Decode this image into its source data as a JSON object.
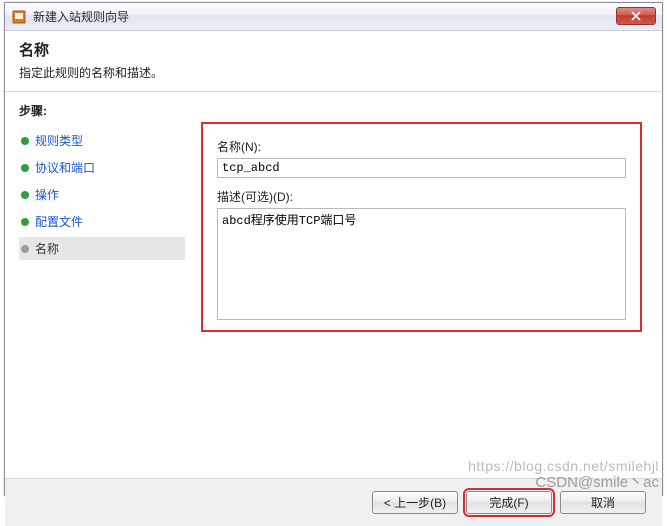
{
  "titlebar": {
    "title": "新建入站规则向导"
  },
  "header": {
    "heading": "名称",
    "subheading": "指定此规则的名称和描述。"
  },
  "sidebar": {
    "steps_label": "步骤:",
    "items": [
      {
        "label": "规则类型"
      },
      {
        "label": "协议和端口"
      },
      {
        "label": "操作"
      },
      {
        "label": "配置文件"
      },
      {
        "label": "名称"
      }
    ]
  },
  "form": {
    "name_label": "名称(N):",
    "name_value": "tcp_abcd",
    "desc_label": "描述(可选)(D):",
    "desc_value": "abcd程序使用TCP端口号"
  },
  "footer": {
    "back": "< 上一步(B)",
    "finish": "完成(F)",
    "cancel": "取消"
  },
  "watermark": {
    "line1": "https://blog.csdn.net/smilehjl",
    "line2": "CSDN@smile丶ac"
  }
}
